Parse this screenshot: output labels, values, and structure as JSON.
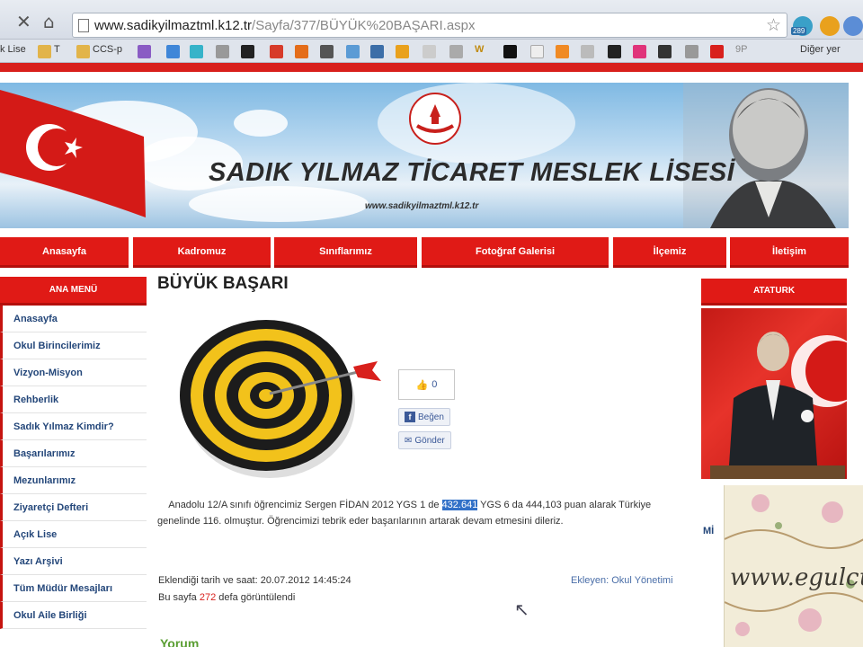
{
  "browser": {
    "url_host": "www.sadikyilmaztml.k12.tr",
    "url_path": "/Sayfa/377/BÜYÜK%20BAŞARI.aspx",
    "bookmarks": [
      "k Lise",
      "T",
      "CCS-p",
      "W",
      "9P",
      "Diğer yer"
    ],
    "extension_badge": "289"
  },
  "header": {
    "school_name": "SADIK YILMAZ TİCARET MESLEK LİSESİ",
    "school_url": "www.sadikyilmaztml.k12.tr"
  },
  "menu": [
    "Anasayfa",
    "Kadromuz",
    "Sınıflarımız",
    "Fotoğraf Galerisi",
    "İlçemiz",
    "İletişim"
  ],
  "sidebar": {
    "title": "ANA MENÜ",
    "items": [
      "Anasayfa",
      "Okul Birincilerimiz",
      "Vizyon-Misyon",
      "Rehberlik",
      "Sadık Yılmaz Kimdir?",
      "Başarılarımız",
      "Mezunlarımız",
      "Ziyaretçi Defteri",
      "Açık Lise",
      "Yazı Arşivi",
      "Tüm Müdür Mesajları",
      "Okul Aile Birliği"
    ]
  },
  "main": {
    "title": "BÜYÜK BAŞARI",
    "like_count": "0",
    "share_label": "Beğen",
    "send_label": "Gönder",
    "article_pre": "Anadolu 12/A sınıfı öğrencimiz Sergen FİDAN 2012 YGS 1 de ",
    "article_highlight": "432.641",
    "article_post": " YGS 6 da 444,103 puan alarak Türkiye genelinde 116. olmuştur. Öğrencimizi tebrik eder başarılarının artarak devam etmesini dileriz.",
    "date_line": "Eklendiği tarih ve saat: 20.07.2012 14:45:24",
    "views_pre": "Bu sayfa ",
    "views_count": "272",
    "views_post": " defa görüntülendi",
    "author_line": "Ekleyen: Okul Yönetimi",
    "bottom_fragment": "Yorum"
  },
  "right": {
    "title": "ATATURK",
    "fragment": "Mİ"
  },
  "watermark": {
    "text": "www.egulcu"
  }
}
